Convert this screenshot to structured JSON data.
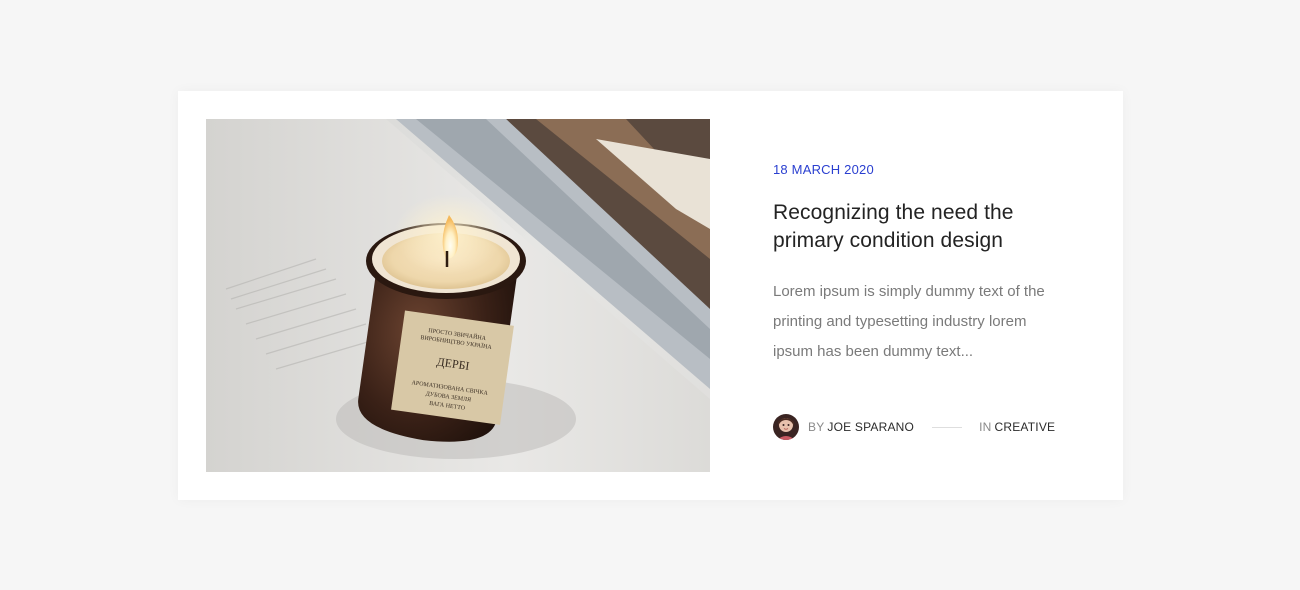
{
  "post": {
    "image_alt": "Lit candle in an amber glass jar on an open book",
    "jar_label": {
      "line1": "ПРОСТО ЗВИЧАЙНА",
      "line2": "ВИРОБНИЦТВО УКРАЇНА",
      "name": "ДЕРБІ",
      "line3": "АРОМАТИЗОВАНА СВІЧКА",
      "line4": "ДУБОВА ЗЕМЛЯ",
      "line5": "ВАГА НЕТТО"
    },
    "date": "18 MARCH 2020",
    "title": "Recognizing the need the primary condition design",
    "excerpt": "Lorem ipsum is simply dummy text of the printing and typesetting industry lorem ipsum has been dummy text...",
    "author_prefix": "BY",
    "author": "JOE SPARANO",
    "category_prefix": "IN",
    "category": "CREATIVE"
  },
  "colors": {
    "page_bg": "#f6f6f6",
    "card_bg": "#ffffff",
    "accent": "#2a3fd0",
    "title": "#232323",
    "body_text": "#7a7a7a"
  }
}
